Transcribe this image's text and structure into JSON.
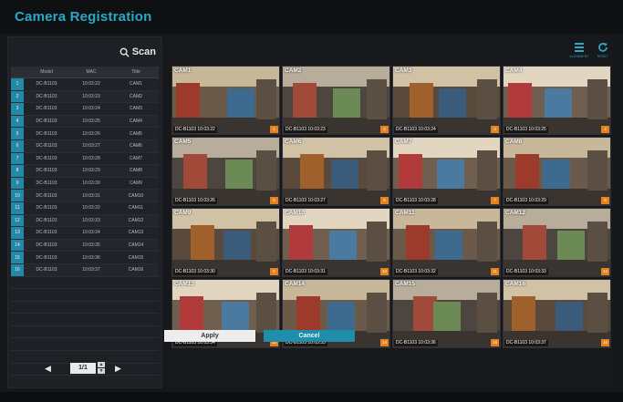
{
  "window": {
    "title": "Camera Registration"
  },
  "scan": {
    "label": "Scan"
  },
  "table": {
    "columns": [
      "Model",
      "MAC",
      "Title"
    ],
    "rows": [
      {
        "num": "1",
        "model": "DC-B1103",
        "mac": "10:03:22",
        "title": "CAM1"
      },
      {
        "num": "2",
        "model": "DC-B1103",
        "mac": "10:03:23",
        "title": "CAM2"
      },
      {
        "num": "3",
        "model": "DC-B1103",
        "mac": "10:03:24",
        "title": "CAM3"
      },
      {
        "num": "4",
        "model": "DC-B1103",
        "mac": "10:03:25",
        "title": "CAM4"
      },
      {
        "num": "5",
        "model": "DC-B1103",
        "mac": "10:03:26",
        "title": "CAM5"
      },
      {
        "num": "6",
        "model": "DC-B1103",
        "mac": "10:03:27",
        "title": "CAM6"
      },
      {
        "num": "7",
        "model": "DC-B1103",
        "mac": "10:03:28",
        "title": "CAM7"
      },
      {
        "num": "8",
        "model": "DC-B1103",
        "mac": "10:03:29",
        "title": "CAM8"
      },
      {
        "num": "9",
        "model": "DC-B1103",
        "mac": "10:03:30",
        "title": "CAM9"
      },
      {
        "num": "10",
        "model": "DC-B1103",
        "mac": "10:03:31",
        "title": "CAM10"
      },
      {
        "num": "11",
        "model": "DC-B1103",
        "mac": "10:03:32",
        "title": "CAM11"
      },
      {
        "num": "12",
        "model": "DC-B1103",
        "mac": "10:03:33",
        "title": "CAM12"
      },
      {
        "num": "13",
        "model": "DC-B1103",
        "mac": "10:03:34",
        "title": "CAM13"
      },
      {
        "num": "14",
        "model": "DC-B1103",
        "mac": "10:03:35",
        "title": "CAM14"
      },
      {
        "num": "15",
        "model": "DC-B1103",
        "mac": "10:03:36",
        "title": "CAM15"
      },
      {
        "num": "16",
        "model": "DC-B1103",
        "mac": "10:03:37",
        "title": "CAM16"
      }
    ],
    "empty_rows": 8
  },
  "pager": {
    "page": "1/1"
  },
  "toolbar": {
    "alignment_label": "ALIGNMENT",
    "reset_label": "RESET"
  },
  "grid": {
    "tiles": [
      {
        "label": "CAM1",
        "info": "DC-B1103 10:03:22",
        "badge": "1"
      },
      {
        "label": "CAM2",
        "info": "DC-B1103 10:03:23",
        "badge": "2"
      },
      {
        "label": "CAM3",
        "info": "DC-B1103 10:03:24",
        "badge": "3"
      },
      {
        "label": "CAM4",
        "info": "DC-B1103 10:03:25",
        "badge": "4"
      },
      {
        "label": "CAM5",
        "info": "DC-B1103 10:03:26",
        "badge": "5"
      },
      {
        "label": "CAM6",
        "info": "DC-B1103 10:03:27",
        "badge": "6"
      },
      {
        "label": "CAM7",
        "info": "DC-B1103 10:03:28",
        "badge": "7"
      },
      {
        "label": "CAM8",
        "info": "DC-B1103 10:03:29",
        "badge": "8"
      },
      {
        "label": "CAM9",
        "info": "DC-B1103 10:03:30",
        "badge": "9"
      },
      {
        "label": "CAM10",
        "info": "DC-B1103 10:03:31",
        "badge": "10"
      },
      {
        "label": "CAM11",
        "info": "DC-B1103 10:03:32",
        "badge": "11"
      },
      {
        "label": "CAM12",
        "info": "DC-B1103 10:03:33",
        "badge": "12"
      },
      {
        "label": "CAM13",
        "info": "DC-B1103 10:03:34",
        "badge": "13"
      },
      {
        "label": "CAM14",
        "info": "DC-B1103 10:03:35",
        "badge": "14"
      },
      {
        "label": "CAM15",
        "info": "DC-B1103 10:03:36",
        "badge": "15"
      },
      {
        "label": "CAM16",
        "info": "DC-B1103 10:03:37",
        "badge": "16"
      }
    ]
  },
  "buttons": {
    "apply": "Apply",
    "cancel": "Cancel"
  },
  "colors": {
    "accent": "#2aa8c6",
    "badge": "#e5821f"
  }
}
